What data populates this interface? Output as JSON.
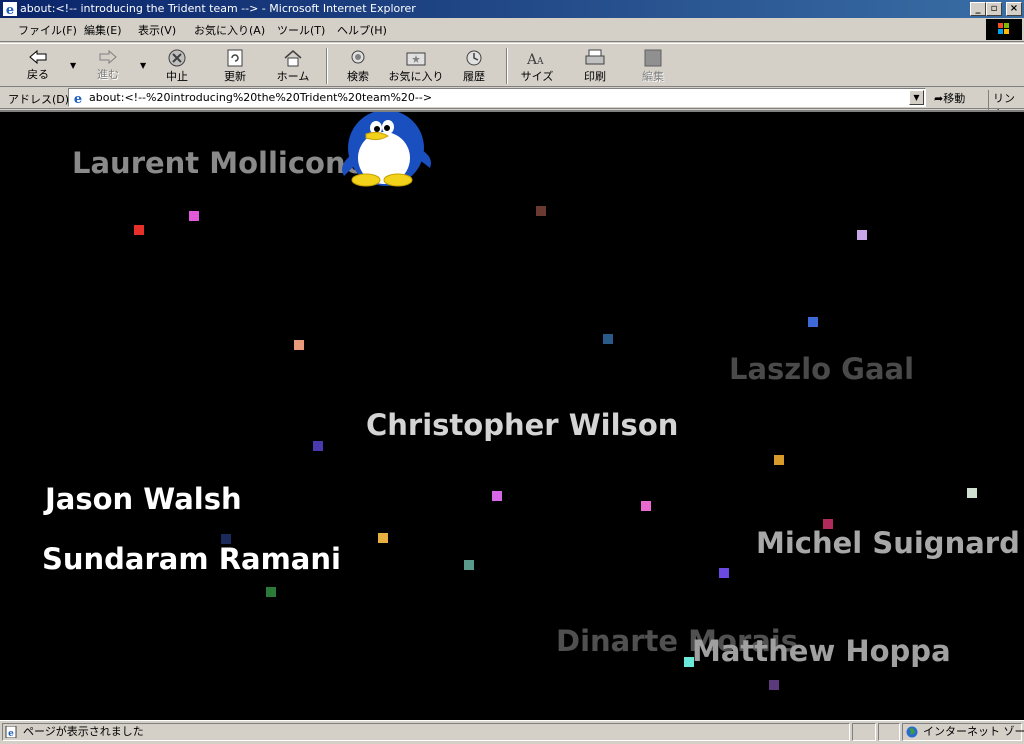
{
  "window": {
    "title": "about:<!-- introducing the Trident team --> - Microsoft Internet Explorer",
    "controls": {
      "minimize": "_",
      "maximize": "▫",
      "close": "×"
    }
  },
  "menu": [
    "ファイル(F)",
    "編集(E)",
    "表示(V)",
    "お気に入り(A)",
    "ツール(T)",
    "ヘルプ(H)"
  ],
  "toolbar": {
    "back": "戻る",
    "forward": "進む",
    "stop": "中止",
    "refresh": "更新",
    "home": "ホーム",
    "search": "検索",
    "favorites": "お気に入り",
    "history": "履歴",
    "size": "サイズ",
    "print": "印刷",
    "edit": "編集"
  },
  "address": {
    "label": "アドレス(D)",
    "url": "about:<!--%20introducing%20the%20Trident%20team%20-->",
    "go": "移動",
    "links": "リンク"
  },
  "credits": [
    {
      "name": "Laurent Mollicone",
      "color": "#8a8a8a"
    },
    {
      "name": "Laszlo Gaal",
      "color": "#4a4a4a"
    },
    {
      "name": "Christopher Wilson",
      "color": "#d4d4d4"
    },
    {
      "name": "Jason Walsh",
      "color": "#ffffff"
    },
    {
      "name": "Sundaram Ramani",
      "color": "#ffffff"
    },
    {
      "name": "Michel Suignard",
      "color": "#a8a8a8"
    },
    {
      "name": "Dinarte Morais",
      "color": "#505050"
    },
    {
      "name": "Matthew Hoppa",
      "color": "#a0a0a0"
    }
  ],
  "status": {
    "text": "ページが表示されました",
    "zone": "インターネット ゾーン"
  }
}
